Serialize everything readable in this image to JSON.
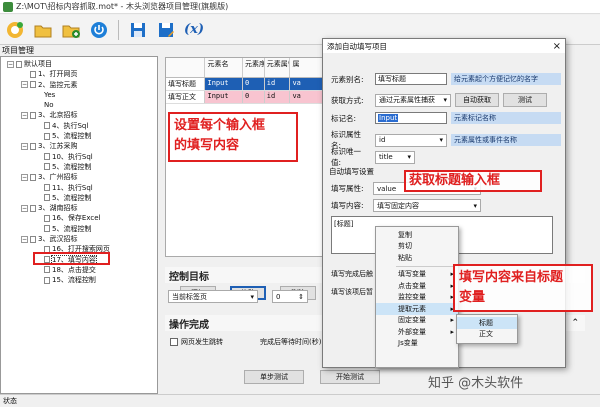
{
  "window": {
    "title": "Z:\\MOT\\招标内容抓取.mot* - 木头浏览器项目管理(旗舰版)"
  },
  "toolbar": {
    "icons": [
      "new-icon",
      "open-icon",
      "add-icon",
      "power-icon",
      "save-icon",
      "save-as-icon",
      "variable-icon"
    ],
    "variable_label": "(x)"
  },
  "left_panel": {
    "title": "项目管理",
    "tree": [
      {
        "label": "默认项目",
        "depth": 0,
        "expander": "−",
        "kind": "root"
      },
      {
        "label": "1、打开网页",
        "depth": 1,
        "expander": "",
        "kind": "file"
      },
      {
        "label": "2、监控元素",
        "depth": 1,
        "expander": "−",
        "kind": "file"
      },
      {
        "label": "Yes",
        "depth": 2,
        "expander": "",
        "kind": "leaf"
      },
      {
        "label": "No",
        "depth": 2,
        "expander": "",
        "kind": "leaf"
      },
      {
        "label": "3、北京招标",
        "depth": 1,
        "expander": "−",
        "kind": "file"
      },
      {
        "label": "4、执行Sql",
        "depth": 2,
        "expander": "",
        "kind": "file"
      },
      {
        "label": "5、流程控制",
        "depth": 2,
        "expander": "",
        "kind": "file"
      },
      {
        "label": "3、江苏采购",
        "depth": 1,
        "expander": "−",
        "kind": "file"
      },
      {
        "label": "10、执行Sql",
        "depth": 2,
        "expander": "",
        "kind": "file"
      },
      {
        "label": "5、流程控制",
        "depth": 2,
        "expander": "",
        "kind": "file"
      },
      {
        "label": "3、广州招标",
        "depth": 1,
        "expander": "−",
        "kind": "file"
      },
      {
        "label": "11、执行Sql",
        "depth": 2,
        "expander": "",
        "kind": "file"
      },
      {
        "label": "5、流程控制",
        "depth": 2,
        "expander": "",
        "kind": "file"
      },
      {
        "label": "3、湖南招标",
        "depth": 1,
        "expander": "−",
        "kind": "file"
      },
      {
        "label": "16、保存Excel",
        "depth": 2,
        "expander": "",
        "kind": "file"
      },
      {
        "label": "5、流程控制",
        "depth": 2,
        "expander": "",
        "kind": "file"
      },
      {
        "label": "3、武汉招标",
        "depth": 1,
        "expander": "−",
        "kind": "file"
      },
      {
        "label": "16、打开搜索网页",
        "depth": 2,
        "expander": "",
        "kind": "file"
      },
      {
        "label": "17、填写内容",
        "depth": 2,
        "expander": "",
        "kind": "file",
        "selected": true
      },
      {
        "label": "18、点击提交",
        "depth": 2,
        "expander": "",
        "kind": "file"
      },
      {
        "label": "15、流程控制",
        "depth": 2,
        "expander": "",
        "kind": "file"
      }
    ]
  },
  "grid": {
    "columns": [
      "",
      "元素名",
      "元素序号",
      "元素属性",
      "属"
    ],
    "rows": [
      {
        "cells": [
          "填写标题",
          "Input",
          "0",
          "id",
          "va"
        ],
        "style": "blue"
      },
      {
        "cells": [
          "填写正文",
          "Input",
          "0",
          "id",
          "va"
        ],
        "style": "pink"
      }
    ]
  },
  "buttons": {
    "add": "添加",
    "modify": "修改",
    "delete": "删除"
  },
  "control_target": {
    "title": "控制目标",
    "tab_combo": "当前标签页",
    "number": "0"
  },
  "operation_done": {
    "title": "操作完成",
    "checkbox": "网页发生跳转",
    "wait_label": "完成后等待时间(秒)",
    "wait_value": "0"
  },
  "bottom_buttons": {
    "single_test": "单步测试",
    "start_test": "开始测试",
    "stop": "停止"
  },
  "status": "状态",
  "dialog": {
    "title": "添加自动填写项目",
    "close": "×",
    "alias_label": "元素别名:",
    "alias_value": "填写标题",
    "alias_hint": "给元素起个方便记忆的名字",
    "method_label": "获取方式:",
    "method_value": "通过元素属性捕获",
    "auto_get": "自动获取",
    "test": "测试",
    "tag_label": "标记名:",
    "tag_value": "Input",
    "tag_hint": "元素标记名称",
    "attr_label": "标识属性名:",
    "attr_value": "id",
    "attr_hint": "元素属性或事件名称",
    "unique_label": "标识唯一值:",
    "unique_value": "title",
    "section_title": "自动填写设置",
    "fill_attr_label": "填写属性:",
    "fill_attr_value": "value",
    "fill_content_label": "填写内容:",
    "fill_content_value": "填写固定内容",
    "textarea_value": "[标题]",
    "after_label": "填写完成后触",
    "method2_label": "填写该项后暂"
  },
  "context_menu": {
    "items": [
      {
        "label": "复制",
        "arrow": false,
        "highlight": false
      },
      {
        "label": "剪切",
        "arrow": false,
        "highlight": false
      },
      {
        "label": "粘贴",
        "arrow": false,
        "highlight": false
      },
      {
        "label": "填写变量",
        "arrow": true,
        "highlight": false,
        "sep_before": true
      },
      {
        "label": "点击变量",
        "arrow": true,
        "highlight": false
      },
      {
        "label": "监控变量",
        "arrow": true,
        "highlight": false
      },
      {
        "label": "提取元素",
        "arrow": true,
        "highlight": true
      },
      {
        "label": "固定变量",
        "arrow": true,
        "highlight": false
      },
      {
        "label": "外部变量",
        "arrow": true,
        "highlight": false
      },
      {
        "label": "Js变量",
        "arrow": false,
        "highlight": false
      }
    ],
    "submenu": [
      {
        "label": "标题",
        "highlight": true
      },
      {
        "label": "正文",
        "highlight": false
      }
    ]
  },
  "annotations": {
    "a1_line1": "设置每个输入框",
    "a1_line2": "的填写内容",
    "a2": "获取标题输入框",
    "a3_line1": "填写内容来自标题",
    "a3_line2": "变量"
  },
  "watermark": "知乎 @木头软件",
  "colors": {
    "accent_red": "#e02020",
    "hint_blue": "#c6dbf3",
    "row_blue": "#1e5fb4",
    "row_pink": "#f8c4d0"
  }
}
